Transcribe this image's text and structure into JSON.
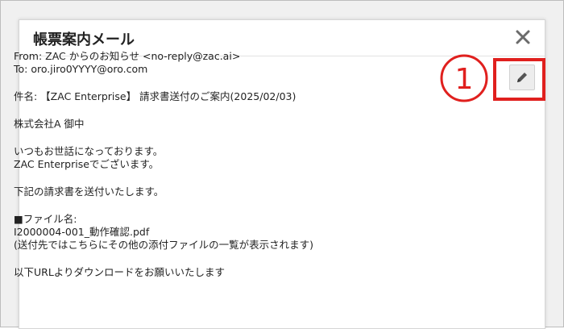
{
  "dialog": {
    "title": "帳票案内メール",
    "close_icon": "close-icon",
    "edit_icon": "pencil-icon"
  },
  "email": {
    "from": "From: ZAC からのお知らせ <no-reply@zac.ai>",
    "to": "To: oro.jiro0YYYY@oro.com",
    "subject": "件名: 【ZAC Enterprise】 請求書送付のご案内(2025/02/03)",
    "addressee": "株式会社A 御中",
    "greeting_1": "いつもお世話になっております。",
    "greeting_2": "ZAC Enterpriseでございます。",
    "intro": "下記の請求書を送付いたします。",
    "file_label": "■ファイル名:",
    "file_name": "I2000004-001_動作確認.pdf",
    "file_note": "(送付先ではこちらにその他の添付ファイルの一覧が表示されます)",
    "download_line": "以下URLよりダウンロードをお願いいたします"
  },
  "annotation": {
    "number": "①",
    "color": "#e0201e"
  }
}
